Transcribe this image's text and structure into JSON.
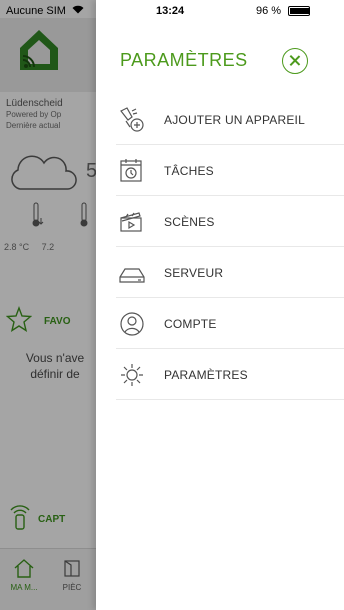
{
  "status_bar": {
    "carrier": "Aucune SIM",
    "time": "13:24",
    "battery": "96 %",
    "battery_level": 0.96
  },
  "background": {
    "location": "Lüdenscheid",
    "powered_by": "Powered by Op",
    "last_update": "Dernière actual",
    "temp_big": "5",
    "temps": [
      "2.8 °C",
      "7.2"
    ],
    "favorites_label": "FAVO",
    "favorites_text_1": "Vous n'ave",
    "favorites_text_2": "définir de",
    "sensors_label": "CAPT",
    "tabs": [
      "MA M...",
      "PIÈC"
    ]
  },
  "drawer": {
    "title": "PARAMÈTRES",
    "items": [
      {
        "label": "AJOUTER UN APPAREIL",
        "icon": "add-device-icon"
      },
      {
        "label": "TÂCHES",
        "icon": "calendar-clock-icon"
      },
      {
        "label": "SCÈNES",
        "icon": "clapperboard-icon"
      },
      {
        "label": "SERVEUR",
        "icon": "server-icon"
      },
      {
        "label": "COMPTE",
        "icon": "user-icon"
      },
      {
        "label": "PARAMÈTRES",
        "icon": "gear-icon"
      }
    ]
  },
  "colors": {
    "accent": "#4c9a1c",
    "text": "#333333",
    "overlay": "rgba(0,0,0,0.30)"
  }
}
